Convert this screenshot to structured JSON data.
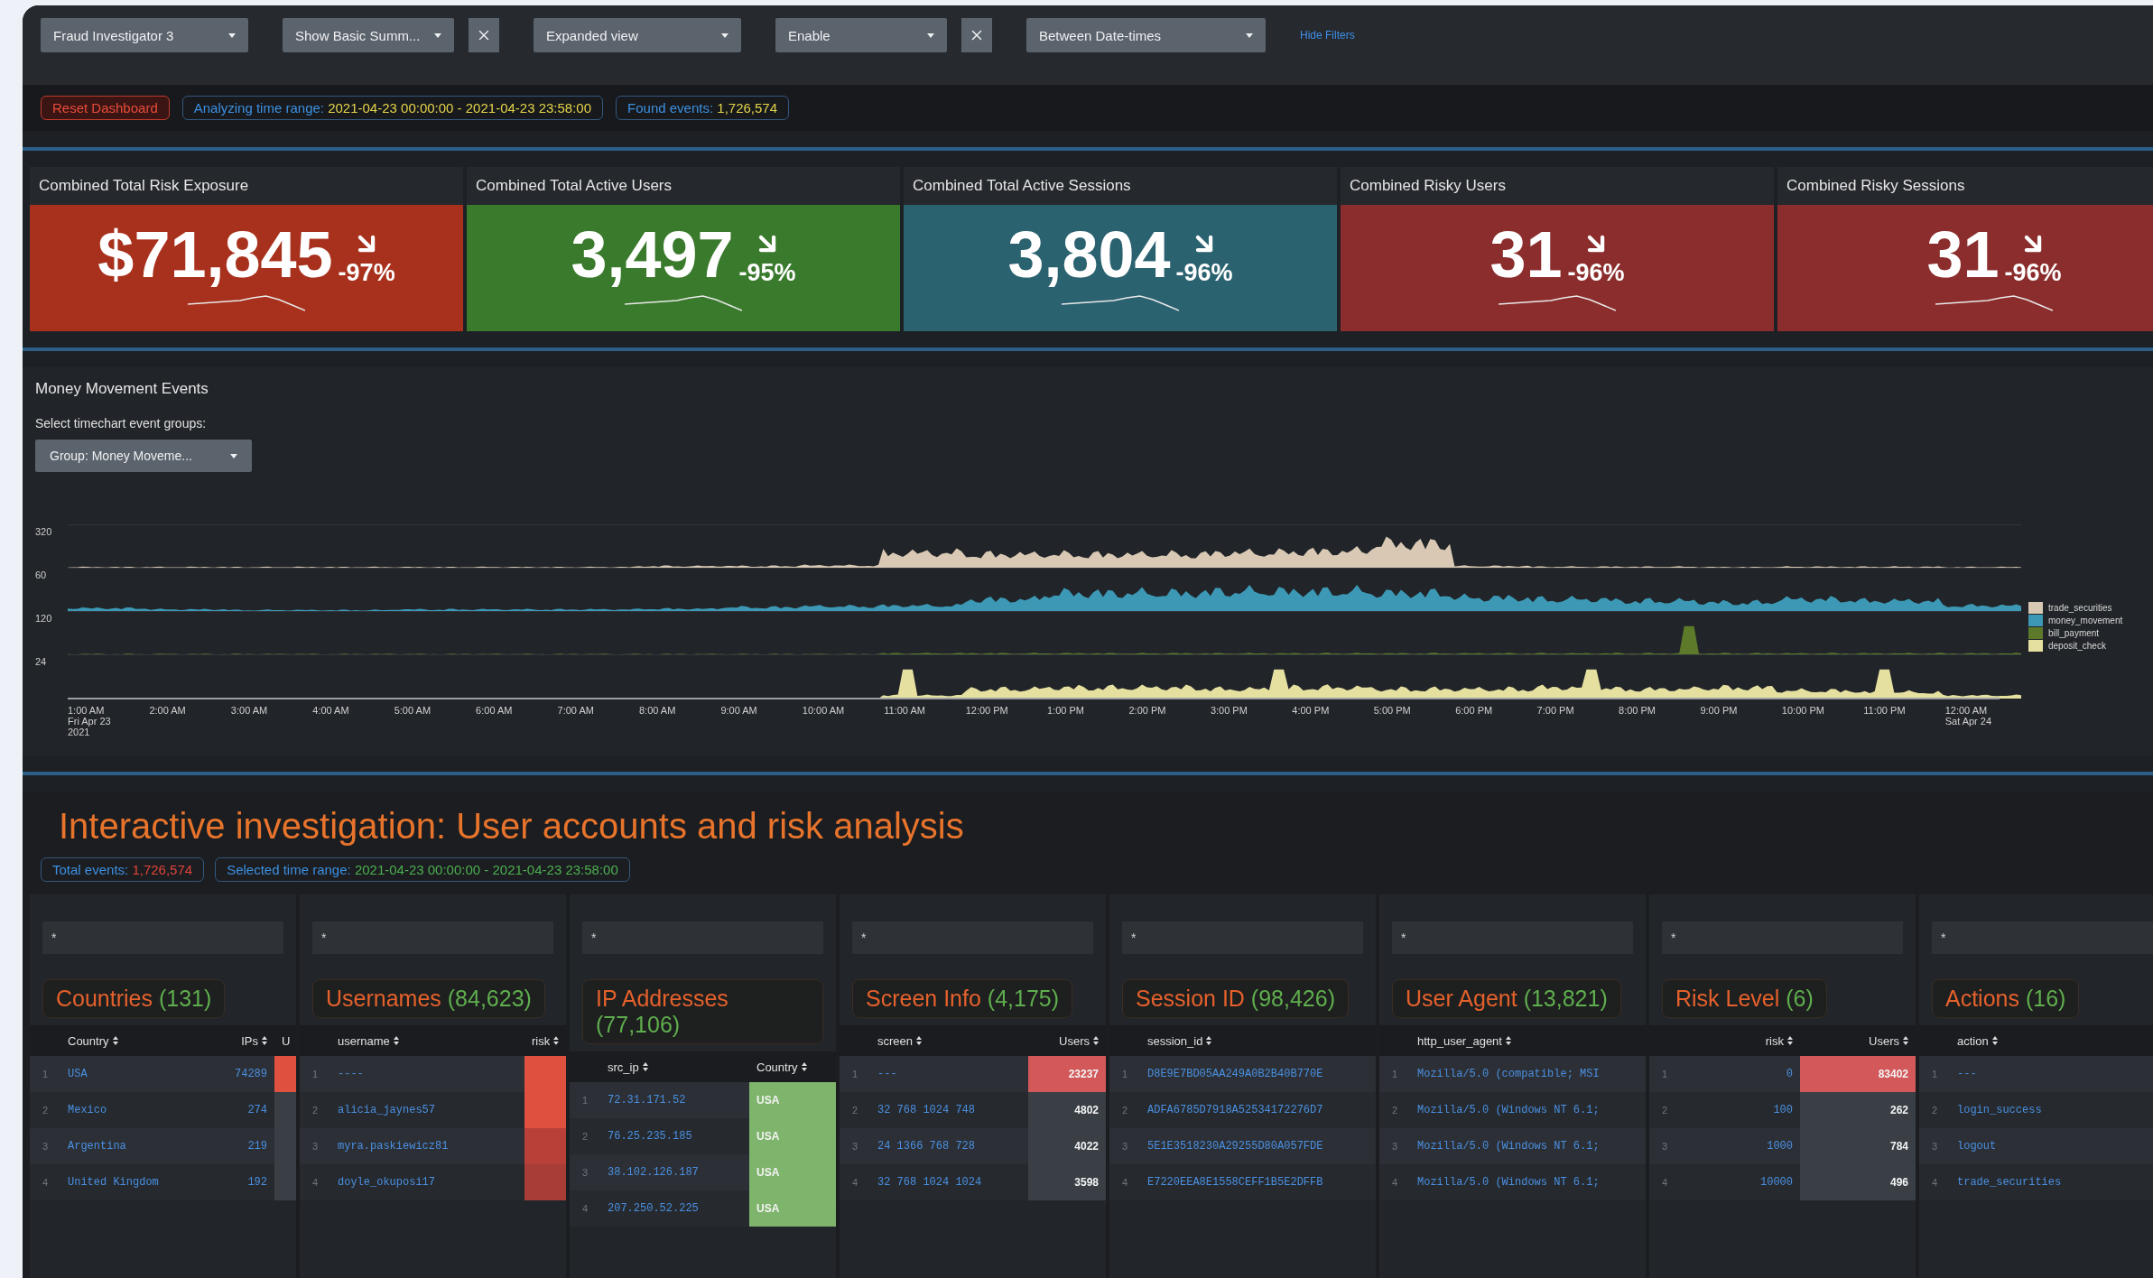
{
  "filters": [
    {
      "value": "Fraud Investigator 3",
      "clearable": false
    },
    {
      "value": "Show Basic Summ...",
      "clearable": true
    },
    {
      "value": "Expanded view",
      "clearable": false
    },
    {
      "value": "Enable",
      "clearable": true
    },
    {
      "value": "Between Date-times",
      "clearable": false
    }
  ],
  "hide_filters_link": "Hide Filters",
  "status_pills": [
    {
      "kind": "button",
      "label": "Reset Dashboard"
    },
    {
      "kind": "info",
      "label": "Analyzing time range:",
      "value": "2021-04-23 00:00:00 - 2021-04-23 23:58:00",
      "color": "#e3d34a"
    },
    {
      "kind": "info",
      "label": "Found events:",
      "value": "1,726,574",
      "color": "#e3d34a"
    }
  ],
  "kpis": [
    {
      "label": "Combined Total Risk Exposure",
      "value": "$71,845",
      "delta": "-97%",
      "color": "#a8311d"
    },
    {
      "label": "Combined Total Active Users",
      "value": "3,497",
      "delta": "-95%",
      "color": "#3a7a2c"
    },
    {
      "label": "Combined Total Active Sessions",
      "value": "3,804",
      "delta": "-96%",
      "color": "#2b6270"
    },
    {
      "label": "Combined Risky Users",
      "value": "31",
      "delta": "-96%",
      "color": "#8c2d2d"
    },
    {
      "label": "Combined Risky Sessions",
      "value": "31",
      "delta": "-96%",
      "color": "#8c2d2d"
    }
  ],
  "chart": {
    "title": "Money Movement Events",
    "selector_label": "Select timechart event groups:",
    "selector_value": "Group: Money Moveme...",
    "series": [
      {
        "name": "trade_securities",
        "color": "#d8c8b4",
        "axis_label": "320"
      },
      {
        "name": "money_movement",
        "color": "#3c98b4",
        "axis_label": "60"
      },
      {
        "name": "bill_payment",
        "color": "#5c7a2a",
        "axis_label": "120"
      },
      {
        "name": "deposit_check",
        "color": "#e6e0a0",
        "axis_label": "24"
      }
    ],
    "x_labels": [
      "1:00 AM\nFri Apr 23\n2021",
      "2:00 AM",
      "3:00 AM",
      "4:00 AM",
      "5:00 AM",
      "6:00 AM",
      "7:00 AM",
      "8:00 AM",
      "9:00 AM",
      "10:00 AM",
      "11:00 AM",
      "12:00 PM",
      "1:00 PM",
      "2:00 PM",
      "3:00 PM",
      "4:00 PM",
      "5:00 PM",
      "6:00 PM",
      "7:00 PM",
      "8:00 PM",
      "9:00 PM",
      "10:00 PM",
      "11:00 PM",
      "12:00 AM\nSat Apr 24"
    ]
  },
  "investigation": {
    "title": "Interactive investigation: User accounts and risk analysis",
    "pills": [
      {
        "label": "Total events:",
        "value": "1,726,574",
        "color": "#e0443a"
      },
      {
        "label": "Selected time range:",
        "value": "2021-04-23 00:00:00 - 2021-04-23 23:58:00",
        "color": "#4caf50"
      }
    ],
    "panels": [
      {
        "title": "Countries",
        "count": "(131)",
        "filter_value": "*",
        "columns": [
          "Country",
          "IPs",
          "U"
        ],
        "rows": [
          {
            "n": "1",
            "cells": [
              {
                "text": "USA"
              },
              {
                "text": "74289"
              },
              {
                "color": "#e0503f"
              }
            ]
          },
          {
            "n": "2",
            "cells": [
              {
                "text": "Mexico"
              },
              {
                "text": "274"
              },
              {
                "color": "#3a3f46"
              }
            ]
          },
          {
            "n": "3",
            "cells": [
              {
                "text": "Argentina"
              },
              {
                "text": "219"
              },
              {
                "color": "#3a3f46"
              }
            ]
          },
          {
            "n": "4",
            "cells": [
              {
                "text": "United Kingdom"
              },
              {
                "text": "192"
              },
              {
                "color": "#3a3f46"
              }
            ]
          }
        ]
      },
      {
        "title": "Usernames",
        "count": "(84,623)",
        "filter_value": "*",
        "columns": [
          "username",
          "risk"
        ],
        "rows": [
          {
            "n": "1",
            "cells": [
              {
                "text": "----"
              },
              {
                "color": "#e0503f"
              }
            ]
          },
          {
            "n": "2",
            "cells": [
              {
                "text": "alicia_jaynes57"
              },
              {
                "color": "#e0503f"
              }
            ]
          },
          {
            "n": "3",
            "cells": [
              {
                "text": "myra.paskiewicz81"
              },
              {
                "color": "#b84038"
              }
            ]
          },
          {
            "n": "4",
            "cells": [
              {
                "text": "doyle_okuposi17"
              },
              {
                "color": "#a83c36"
              }
            ]
          }
        ]
      },
      {
        "title": "IP Addresses",
        "count": "(77,106)",
        "filter_value": "*",
        "columns": [
          "src_ip",
          "Country"
        ],
        "rows": [
          {
            "n": "1",
            "cells": [
              {
                "text": "72.31.171.52"
              },
              {
                "text": "USA",
                "color": "#7fb46c"
              }
            ]
          },
          {
            "n": "2",
            "cells": [
              {
                "text": "76.25.235.185"
              },
              {
                "text": "USA",
                "color": "#7fb46c"
              }
            ]
          },
          {
            "n": "3",
            "cells": [
              {
                "text": "38.102.126.187"
              },
              {
                "text": "USA",
                "color": "#7fb46c"
              }
            ]
          },
          {
            "n": "4",
            "cells": [
              {
                "text": "207.250.52.225"
              },
              {
                "text": "USA",
                "color": "#7fb46c"
              }
            ]
          }
        ]
      },
      {
        "title": "Screen Info",
        "count": "(4,175)",
        "filter_value": "*",
        "columns": [
          "screen",
          "Users"
        ],
        "rows": [
          {
            "n": "1",
            "cells": [
              {
                "text": "---"
              },
              {
                "text": "23237",
                "color": "#d2585a"
              }
            ]
          },
          {
            "n": "2",
            "cells": [
              {
                "text": "32 768 1024 748"
              },
              {
                "text": "4802",
                "color": "#3a3f46"
              }
            ]
          },
          {
            "n": "3",
            "cells": [
              {
                "text": "24 1366 768 728"
              },
              {
                "text": "4022",
                "color": "#3a3f46"
              }
            ]
          },
          {
            "n": "4",
            "cells": [
              {
                "text": "32 768 1024 1024"
              },
              {
                "text": "3598",
                "color": "#3a3f46"
              }
            ]
          }
        ]
      },
      {
        "title": "Session ID",
        "count": "(98,426)",
        "filter_value": "*",
        "columns": [
          "session_id"
        ],
        "rows": [
          {
            "n": "1",
            "cells": [
              {
                "text": "D8E9E7BD05AA249A0B2B40B770E"
              }
            ]
          },
          {
            "n": "2",
            "cells": [
              {
                "text": "ADFA6785D7918A52534172276D7"
              }
            ]
          },
          {
            "n": "3",
            "cells": [
              {
                "text": "5E1E3518230A29255D80A057FDE"
              }
            ]
          },
          {
            "n": "4",
            "cells": [
              {
                "text": "E7220EEA8E1558CEFF1B5E2DFFB"
              }
            ]
          }
        ]
      },
      {
        "title": "User Agent",
        "count": "(13,821)",
        "filter_value": "*",
        "columns": [
          "http_user_agent"
        ],
        "rows": [
          {
            "n": "1",
            "cells": [
              {
                "text": "Mozilla/5.0 (compatible; MSI"
              }
            ]
          },
          {
            "n": "2",
            "cells": [
              {
                "text": "Mozilla/5.0 (Windows NT 6.1;"
              }
            ]
          },
          {
            "n": "3",
            "cells": [
              {
                "text": "Mozilla/5.0 (Windows NT 6.1;"
              }
            ]
          },
          {
            "n": "4",
            "cells": [
              {
                "text": "Mozilla/5.0 (Windows NT 6.1;"
              }
            ]
          }
        ]
      },
      {
        "title": "Risk Level",
        "count": "(6)",
        "filter_value": "*",
        "columns": [
          "risk",
          "Users"
        ],
        "rows": [
          {
            "n": "1",
            "cells": [
              {
                "text": "0"
              },
              {
                "text": "83402",
                "color": "#d2585a"
              }
            ]
          },
          {
            "n": "2",
            "cells": [
              {
                "text": "100"
              },
              {
                "text": "262",
                "color": "#3a3f46"
              }
            ]
          },
          {
            "n": "3",
            "cells": [
              {
                "text": "1000"
              },
              {
                "text": "784",
                "color": "#3a3f46"
              }
            ]
          },
          {
            "n": "4",
            "cells": [
              {
                "text": "10000"
              },
              {
                "text": "496",
                "color": "#3a3f46"
              }
            ]
          }
        ]
      },
      {
        "title": "Actions",
        "count": "(16)",
        "filter_value": "*",
        "columns": [
          "action"
        ],
        "rows": [
          {
            "n": "1",
            "cells": [
              {
                "text": "---"
              }
            ]
          },
          {
            "n": "2",
            "cells": [
              {
                "text": "login_success"
              }
            ]
          },
          {
            "n": "3",
            "cells": [
              {
                "text": "logout"
              }
            ]
          },
          {
            "n": "4",
            "cells": [
              {
                "text": "trade_securities"
              }
            ]
          }
        ]
      }
    ]
  }
}
